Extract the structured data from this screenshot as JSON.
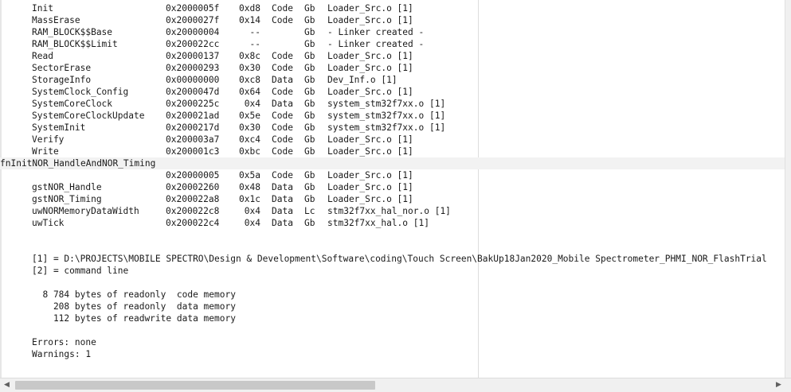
{
  "symbols": [
    {
      "name": "Init",
      "addr": "0x2000005f",
      "size": "0xd8",
      "kind": "Code",
      "scope": "Gb",
      "obj": "Loader_Src.o [1]"
    },
    {
      "name": "MassErase",
      "addr": "0x2000027f",
      "size": "0x14",
      "kind": "Code",
      "scope": "Gb",
      "obj": "Loader_Src.o [1]"
    },
    {
      "name": "RAM_BLOCK$$Base",
      "addr": "0x20000004",
      "size": "--",
      "kind": "",
      "scope": "Gb",
      "obj": "- Linker created -"
    },
    {
      "name": "RAM_BLOCK$$Limit",
      "addr": "0x200022cc",
      "size": "--",
      "kind": "",
      "scope": "Gb",
      "obj": "- Linker created -"
    },
    {
      "name": "Read",
      "addr": "0x20000137",
      "size": "0x8c",
      "kind": "Code",
      "scope": "Gb",
      "obj": "Loader_Src.o [1]"
    },
    {
      "name": "SectorErase",
      "addr": "0x20000293",
      "size": "0x30",
      "kind": "Code",
      "scope": "Gb",
      "obj": "Loader_Src.o [1]"
    },
    {
      "name": "StorageInfo",
      "addr": "0x00000000",
      "size": "0xc8",
      "kind": "Data",
      "scope": "Gb",
      "obj": "Dev_Inf.o [1]"
    },
    {
      "name": "SystemClock_Config",
      "addr": "0x2000047d",
      "size": "0x64",
      "kind": "Code",
      "scope": "Gb",
      "obj": "Loader_Src.o [1]"
    },
    {
      "name": "SystemCoreClock",
      "addr": "0x2000225c",
      "size": "0x4",
      "kind": "Data",
      "scope": "Gb",
      "obj": "system_stm32f7xx.o [1]"
    },
    {
      "name": "SystemCoreClockUpdate",
      "addr": "0x200021ad",
      "size": "0x5e",
      "kind": "Code",
      "scope": "Gb",
      "obj": "system_stm32f7xx.o [1]"
    },
    {
      "name": "SystemInit",
      "addr": "0x2000217d",
      "size": "0x30",
      "kind": "Code",
      "scope": "Gb",
      "obj": "system_stm32f7xx.o [1]"
    },
    {
      "name": "Verify",
      "addr": "0x200003a7",
      "size": "0xc4",
      "kind": "Code",
      "scope": "Gb",
      "obj": "Loader_Src.o [1]"
    },
    {
      "name": "Write",
      "addr": "0x200001c3",
      "size": "0xbc",
      "kind": "Code",
      "scope": "Gb",
      "obj": "Loader_Src.o [1]"
    },
    {
      "name": "fnInitNOR_HandleAndNOR_Timing",
      "addr": "",
      "size": "",
      "kind": "",
      "scope": "",
      "obj": ""
    },
    {
      "name": "",
      "addr": "0x20000005",
      "size": "0x5a",
      "kind": "Code",
      "scope": "Gb",
      "obj": "Loader_Src.o [1]"
    },
    {
      "name": "gstNOR_Handle",
      "addr": "0x20002260",
      "size": "0x48",
      "kind": "Data",
      "scope": "Gb",
      "obj": "Loader_Src.o [1]"
    },
    {
      "name": "gstNOR_Timing",
      "addr": "0x200022a8",
      "size": "0x1c",
      "kind": "Data",
      "scope": "Gb",
      "obj": "Loader_Src.o [1]"
    },
    {
      "name": "uwNORMemoryDataWidth",
      "addr": "0x200022c8",
      "size": "0x4",
      "kind": "Data",
      "scope": "Lc",
      "obj": "stm32f7xx_hal_nor.o [1]"
    },
    {
      "name": "uwTick",
      "addr": "0x200022c4",
      "size": "0x4",
      "kind": "Data",
      "scope": "Gb",
      "obj": "stm32f7xx_hal.o [1]"
    }
  ],
  "footnotes": {
    "line1": "[1] = D:\\PROJECTS\\MOBILE SPECTRO\\Design & Development\\Software\\coding\\Touch Screen\\BakUp18Jan2020_Mobile Spectrometer_PHMI_NOR_FlashTrial",
    "line2": "[2] = command line"
  },
  "memory": {
    "line1": "  8 784 bytes of readonly  code memory",
    "line2": "    208 bytes of readonly  data memory",
    "line3": "    112 bytes of readwrite data memory"
  },
  "status": {
    "errors": "Errors: none",
    "warnings": "Warnings: 1"
  },
  "scrollbar": {
    "left_arrow": "◀",
    "right_arrow": "▶",
    "position_percent": 46
  }
}
